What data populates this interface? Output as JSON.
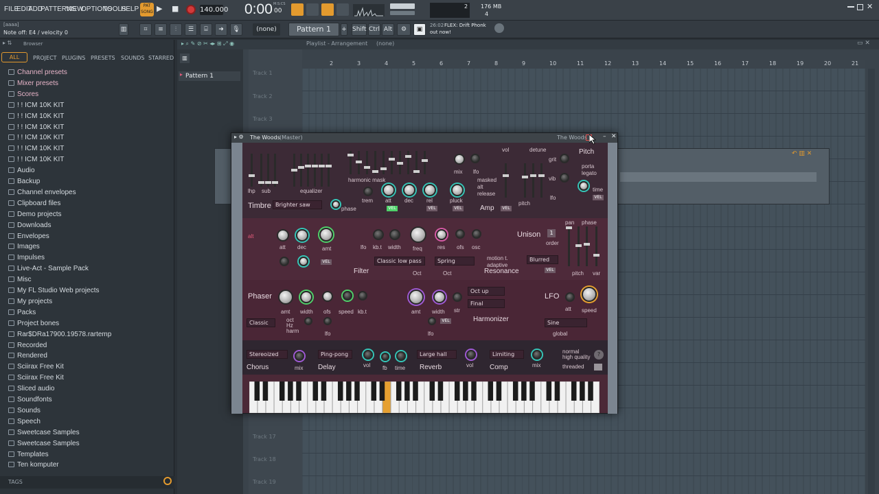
{
  "menu": {
    "items": [
      "FILE",
      "EDIT",
      "ADD",
      "PATTERNS",
      "VIEW",
      "OPTIONS",
      "TOOLS",
      "HELP"
    ],
    "tempo": "140.000",
    "time": "0:00",
    "time_sub": "00",
    "time_unit": "M:S:CS",
    "cpu_value": "2",
    "ram": "176 MB",
    "voices": "4"
  },
  "hint": {
    "line1": "[aaaa]",
    "line2": "Note off: E4 / velocity 0",
    "none_label": "(none)",
    "pattern": "Pattern 1",
    "shift": "Shift",
    "ctrl": "Ctrl",
    "alt": "Alt",
    "news_time": "26:02",
    "news_title": "FLEX: Drift Phonk",
    "news_sub": "out now!"
  },
  "browser": {
    "title": "Browser",
    "tabs": [
      "ALL",
      "PROJECT",
      "PLUGINS",
      "PRESETS",
      "SOUNDS",
      "STARRED"
    ],
    "items": [
      {
        "label": "Channel presets",
        "color": "pink"
      },
      {
        "label": "Mixer presets",
        "color": "pink"
      },
      {
        "label": "Scores",
        "color": "pink"
      },
      {
        "label": "! ! ICM 10K KIT",
        "color": "normal"
      },
      {
        "label": "! ! ICM 10K KIT",
        "color": "normal"
      },
      {
        "label": "! ! ICM 10K KIT",
        "color": "normal"
      },
      {
        "label": "! ! ICM 10K KIT",
        "color": "normal"
      },
      {
        "label": "! ! ICM 10K KIT",
        "color": "normal"
      },
      {
        "label": "! ! ICM 10K KIT",
        "color": "normal"
      },
      {
        "label": "Audio",
        "color": "normal"
      },
      {
        "label": "Backup",
        "color": "normal"
      },
      {
        "label": "Channel envelopes",
        "color": "normal"
      },
      {
        "label": "Clipboard files",
        "color": "normal"
      },
      {
        "label": "Demo projects",
        "color": "normal"
      },
      {
        "label": "Downloads",
        "color": "normal"
      },
      {
        "label": "Envelopes",
        "color": "normal"
      },
      {
        "label": "Images",
        "color": "normal"
      },
      {
        "label": "Impulses",
        "color": "normal"
      },
      {
        "label": "Live-Act - Sample Pack",
        "color": "normal"
      },
      {
        "label": "Misc",
        "color": "normal"
      },
      {
        "label": "My FL Studio Web projects",
        "color": "normal"
      },
      {
        "label": "My projects",
        "color": "normal"
      },
      {
        "label": "Packs",
        "color": "normal"
      },
      {
        "label": "Project bones",
        "color": "normal"
      },
      {
        "label": "Rar$DRa17900.19578.rartemp",
        "color": "normal"
      },
      {
        "label": "Recorded",
        "color": "normal"
      },
      {
        "label": "Rendered",
        "color": "normal"
      },
      {
        "label": "Sciirax Free Kit",
        "color": "normal"
      },
      {
        "label": "Sciirax Free Kit",
        "color": "normal"
      },
      {
        "label": "Sliced audio",
        "color": "normal"
      },
      {
        "label": "Soundfonts",
        "color": "normal"
      },
      {
        "label": "Sounds",
        "color": "normal"
      },
      {
        "label": "Speech",
        "color": "normal"
      },
      {
        "label": "Sweetcase Samples",
        "color": "normal"
      },
      {
        "label": "Sweetcase Samples",
        "color": "normal"
      },
      {
        "label": "Templates",
        "color": "normal"
      },
      {
        "label": "Ten komputer",
        "color": "normal"
      }
    ],
    "tags_label": "TAGS"
  },
  "playlist": {
    "title": "Playlist - Arrangement",
    "selection": "(none)",
    "pattern_item": "Pattern 1",
    "bar_numbers": [
      "2",
      "3",
      "4",
      "5",
      "6",
      "7",
      "8",
      "9",
      "10",
      "11",
      "12",
      "13",
      "14",
      "15",
      "16",
      "17",
      "18",
      "19",
      "20",
      "21"
    ],
    "tracks_top": [
      "Track 1",
      "Track 2",
      "Track 3"
    ],
    "tracks_bottom": [
      "Track 17",
      "Track 18",
      "Track 19"
    ]
  },
  "plugin": {
    "title": "The Woods",
    "title_suffix": "(Master)",
    "title_right": "The Woods",
    "labels": {
      "hp": "lhp",
      "sub": "sub",
      "equalizer": "equalizer",
      "harmonic_mask": "harmonic mask",
      "mix": "mix",
      "lfo": "lfo",
      "vol": "vol",
      "detune": "detune",
      "pitch_title": "Pitch",
      "grit": "grit",
      "vib": "vib",
      "porta": "porta",
      "legato": "legato",
      "time": "time",
      "timbre": "Timbre",
      "timbre_preset": "Brighter saw",
      "phase": "phase",
      "trem": "trem",
      "att": "att",
      "dec": "dec",
      "rel": "rel",
      "pluck": "pluck",
      "amp": "Amp",
      "masked": "masked",
      "alt": "alt",
      "release": "release",
      "pitch": "pitch",
      "alt2": "alt",
      "kbt": "kb.t",
      "width": "width",
      "freq": "freq",
      "res": "res",
      "ofs": "ofs",
      "osc": "osc",
      "amt": "amt",
      "filter": "Filter",
      "filter_type": "Classic low pass",
      "resonance_type": "Spring",
      "resonance": "Resonance",
      "motion": "motion t.",
      "adaptive": "adaptive",
      "oct": "Oct",
      "unison": "Unison",
      "order": "order",
      "order_val": "1",
      "pan": "pan",
      "phase2": "phase",
      "unison_type": "Blurred",
      "var": "var",
      "phaser": "Phaser",
      "speed": "speed",
      "phaser_type": "Classic",
      "oct_small": "oct",
      "hz": "Hz",
      "harm": "harm",
      "harm_mode1": "Oct up",
      "harm_mode2": "Final",
      "str": "str",
      "harmonizer": "Harmonizer",
      "lfo_title": "LFO",
      "lfo_shape": "Sine",
      "global": "global",
      "chorus_type": "Stereoized",
      "chorus": "Chorus",
      "delay_type": "Ping-pong",
      "delay": "Delay",
      "fb": "fb",
      "reverb_type": "Large hall",
      "reverb": "Reverb",
      "comp_type": "Limiting",
      "comp": "Comp",
      "normal": "normal",
      "high_quality": "high quality",
      "threaded": "threaded",
      "vel": "VEL"
    }
  },
  "colors": {
    "accent": "#35c6b8",
    "plugin_bg": "#4b2937",
    "highlight_key": "#e6a030"
  }
}
